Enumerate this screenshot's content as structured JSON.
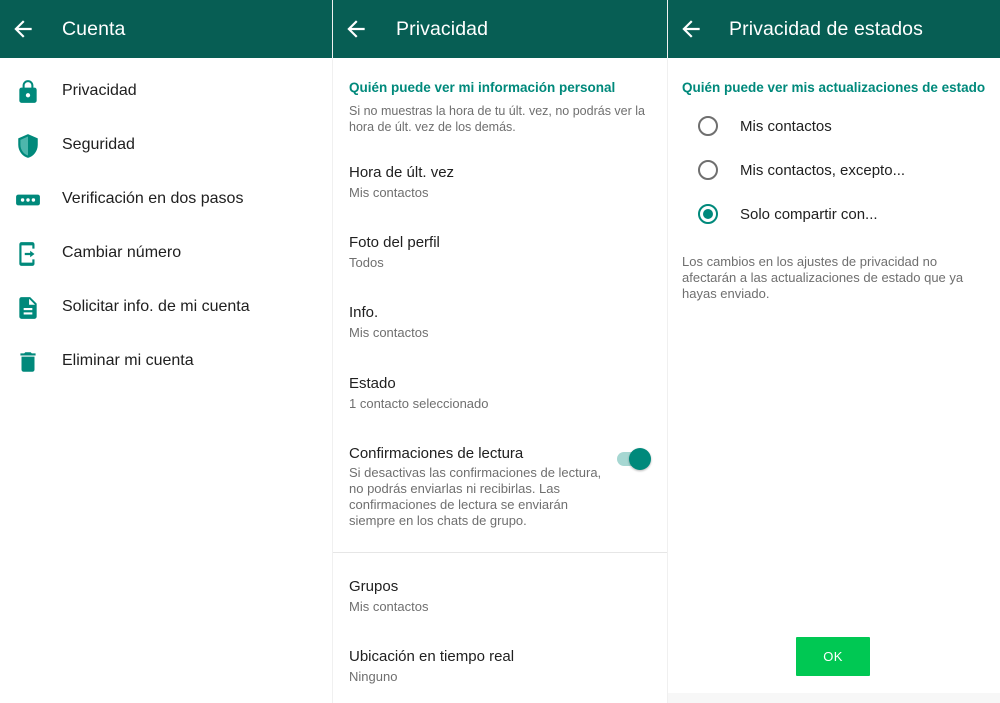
{
  "colors": {
    "appbar": "#075e54",
    "accent": "#00897b",
    "ok_button": "#00c853"
  },
  "panel_account": {
    "title": "Cuenta",
    "items": [
      {
        "label": "Privacidad",
        "icon": "lock-icon"
      },
      {
        "label": "Seguridad",
        "icon": "shield-icon"
      },
      {
        "label": "Verificación en dos pasos",
        "icon": "dots-icon"
      },
      {
        "label": "Cambiar número",
        "icon": "phone-swap-icon"
      },
      {
        "label": "Solicitar info. de mi cuenta",
        "icon": "document-icon"
      },
      {
        "label": "Eliminar mi cuenta",
        "icon": "trash-icon"
      }
    ]
  },
  "panel_privacy": {
    "title": "Privacidad",
    "section_heading": "Quién puede ver mi información personal",
    "section_description": "Si no muestras la hora de tu últ. vez, no podrás ver la hora de últ. vez de los demás.",
    "items": [
      {
        "title": "Hora de últ. vez",
        "subtitle": "Mis contactos"
      },
      {
        "title": "Foto del perfil",
        "subtitle": "Todos"
      },
      {
        "title": "Info.",
        "subtitle": "Mis contactos"
      },
      {
        "title": "Estado",
        "subtitle": "1 contacto seleccionado"
      }
    ],
    "read_receipts": {
      "title": "Confirmaciones de lectura",
      "description": "Si desactivas las confirmaciones de lectura, no podrás enviarlas ni recibirlas. Las confirmaciones de lectura se enviarán siempre en los chats de grupo.",
      "enabled": true
    },
    "lower_items": [
      {
        "title": "Grupos",
        "subtitle": "Mis contactos"
      },
      {
        "title": "Ubicación en tiempo real",
        "subtitle": "Ninguno"
      }
    ]
  },
  "panel_status": {
    "title": "Privacidad de estados",
    "section_heading": "Quién puede ver mis actualizaciones de estado",
    "options": [
      {
        "label": "Mis contactos",
        "checked": false
      },
      {
        "label": "Mis contactos, excepto...",
        "checked": false
      },
      {
        "label": "Solo compartir con...",
        "checked": true
      }
    ],
    "note": "Los cambios en los ajustes de privacidad no afectarán a las actualizaciones de estado que ya hayas enviado.",
    "ok_label": "OK"
  }
}
